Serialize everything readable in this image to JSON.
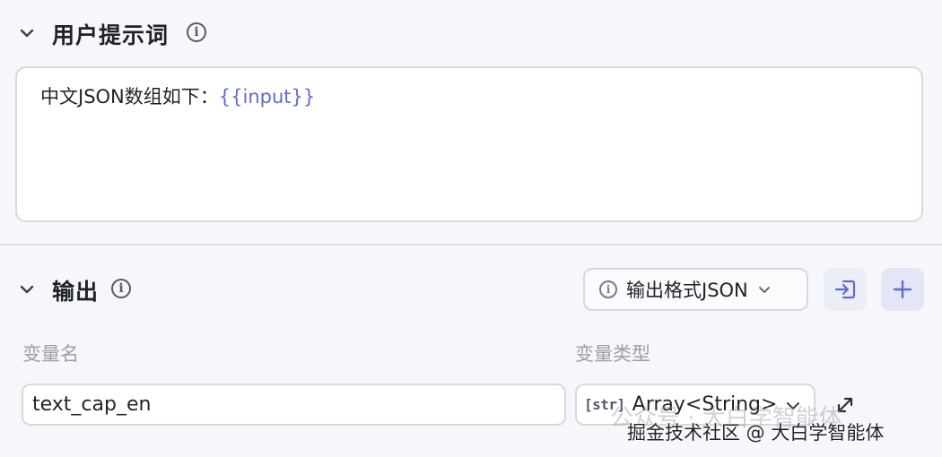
{
  "prompt_section": {
    "title": "用户提示词",
    "info_glyph": "i",
    "text_prefix": "中文JSON数组如下：",
    "text_variable": "{{input}}"
  },
  "output_section": {
    "title": "输出",
    "info_glyph": "i",
    "format_dropdown": {
      "info_glyph": "i",
      "label": "输出格式JSON"
    },
    "import_button_icon": "import-icon",
    "add_button_icon": "plus-icon",
    "columns": {
      "name": "变量名",
      "type": "变量类型"
    },
    "row": {
      "name_value": "text_cap_en",
      "type_icon_text": "[str]",
      "type_value": "Array<String>"
    }
  },
  "watermark": {
    "faint_text": "公众号 · 大白学智能体",
    "text": "掘金技术社区 @ 大白学智能体"
  },
  "colors": {
    "accent": "#5f6bd0",
    "background": "#f6f7fb",
    "border": "#d6d8de"
  }
}
